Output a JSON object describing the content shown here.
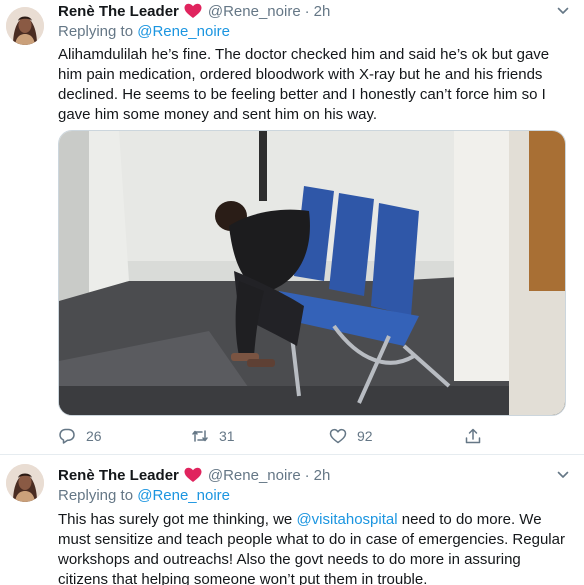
{
  "tweets": [
    {
      "author_name": "Renè The Leader",
      "handle": "@Rene_noire",
      "separator": "·",
      "time": "2h",
      "replying_prefix": "Replying to",
      "replying_handle": "@Rene_noire",
      "body_lines": [
        "Alihamdulilah he’s fine. The doctor checked him and said he’s ok but gave",
        "him pain medication, ordered bloodwork with X-ray but he and his friends",
        "declined. He seems to be feeling better and I honestly can’t force him so I",
        "gave him some money and sent him on his way."
      ],
      "photo_icon": "hospital-waiting-room-photo",
      "reply_count": "26",
      "retweet_count": "31",
      "like_count": "92"
    },
    {
      "author_name": "Renè The Leader",
      "handle": "@Rene_noire",
      "separator": "·",
      "time": "2h",
      "replying_prefix": "Replying to",
      "replying_handle": "@Rene_noire",
      "body_line1_before": "This has surely got me thinking, we ",
      "body_line1_mention": "@visitahospital",
      "body_line1_after": " need to do more. We",
      "body_lines_rest": [
        "must sensitize and teach people what to do in case of emergencies. Regular",
        "workshops and outreachs! Also the govt needs to do more in assuring",
        "citizens that helping someone won’t put them in trouble."
      ]
    }
  ],
  "colors": {
    "link": "#1b95e0",
    "heart": "#e0245e",
    "secondary_text": "#657786",
    "divider": "#e6ecf0"
  },
  "icons": [
    "caret-down-icon",
    "heart-emoji-icon",
    "reply-icon",
    "retweet-icon",
    "like-icon",
    "share-icon"
  ]
}
